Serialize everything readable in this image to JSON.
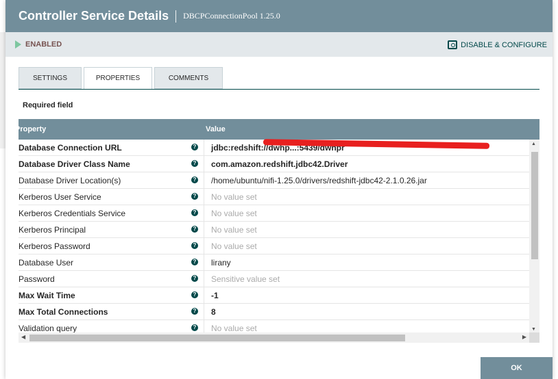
{
  "dialog": {
    "title": "Controller Service Details",
    "subtitle": "DBCPConnectionPool 1.25.0"
  },
  "status": {
    "state": "ENABLED",
    "action": "DISABLE & CONFIGURE"
  },
  "tabs": [
    {
      "label": "SETTINGS"
    },
    {
      "label": "PROPERTIES"
    },
    {
      "label": "COMMENTS"
    }
  ],
  "required_label": "Required field",
  "grid": {
    "col_property": "Property",
    "col_value": "Value",
    "rows": [
      {
        "name": "Database Connection URL",
        "value": "jdbc:redshift://dwhp...:5439/dwhpr"
      },
      {
        "name": "Database Driver Class Name",
        "value": "com.amazon.redshift.jdbc42.Driver"
      },
      {
        "name": "Database Driver Location(s)",
        "value": "/home/ubuntu/nifi-1.25.0/drivers/redshift-jdbc42-2.1.0.26.jar"
      },
      {
        "name": "Kerberos User Service",
        "value": "No value set"
      },
      {
        "name": "Kerberos Credentials Service",
        "value": "No value set"
      },
      {
        "name": "Kerberos Principal",
        "value": "No value set"
      },
      {
        "name": "Kerberos Password",
        "value": "No value set"
      },
      {
        "name": "Database User",
        "value": "lirany"
      },
      {
        "name": "Password",
        "value": "Sensitive value set"
      },
      {
        "name": "Max Wait Time",
        "value": "-1"
      },
      {
        "name": "Max Total Connections",
        "value": "8"
      },
      {
        "name": "Validation query",
        "value": "No value set"
      }
    ]
  },
  "ok_label": "OK",
  "colors": {
    "header": "#728e9b",
    "status_bar": "#e3e8eb",
    "accent": "#004849",
    "enabled_icon": "#7dc7a0"
  }
}
